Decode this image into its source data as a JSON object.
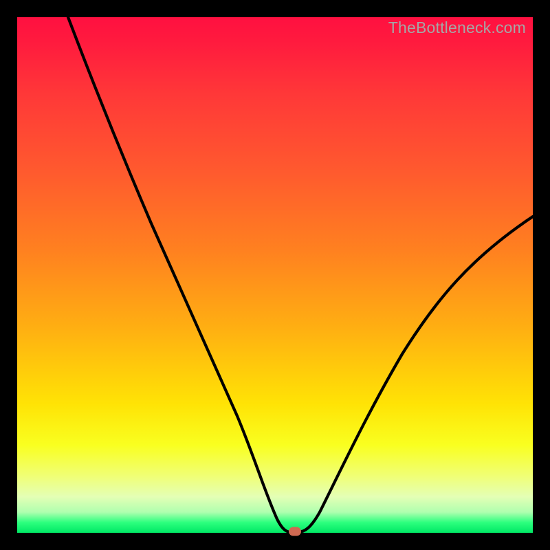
{
  "watermark": "TheBottleneck.com",
  "colors": {
    "gradient_top": "#ff1040",
    "gradient_mid1": "#ff8020",
    "gradient_mid2": "#ffe305",
    "gradient_bottom": "#00e865",
    "curve": "#000000",
    "marker": "#cf6952",
    "frame": "#000000"
  },
  "chart_data": {
    "type": "line",
    "title": "",
    "xlabel": "",
    "ylabel": "",
    "xlim": [
      0,
      100
    ],
    "ylim": [
      0,
      100
    ],
    "x": [
      10,
      15,
      20,
      25,
      30,
      35,
      40,
      45,
      48,
      50,
      52,
      53,
      54,
      56,
      60,
      65,
      70,
      75,
      80,
      85,
      90,
      95,
      100
    ],
    "values": [
      100,
      87,
      75,
      64,
      54,
      44,
      35,
      22,
      12,
      5,
      1,
      0,
      0,
      1,
      6,
      14,
      22,
      30,
      37,
      44,
      50,
      56,
      61
    ],
    "marker": {
      "x": 53.5,
      "y": 0
    },
    "note": "y is percent from bottom (0 = bottom green band, 100 = top red). Curve depicts a bottleneck-style V: steep descent from upper-left, flat minimum near x≈53, then a gentler rise toward the right edge reaching ~61% height."
  }
}
